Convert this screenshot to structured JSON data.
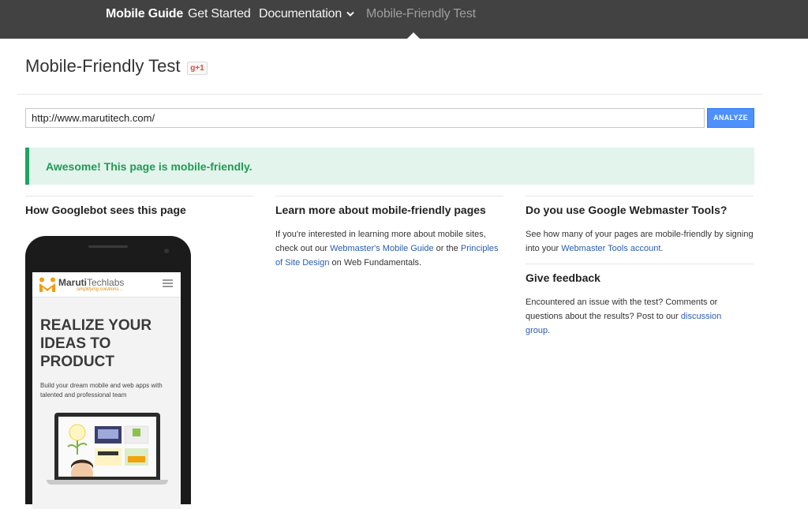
{
  "nav": {
    "brand": "Mobile Guide",
    "items": [
      "Get Started",
      "Documentation",
      "Mobile-Friendly Test"
    ]
  },
  "header": {
    "title": "Mobile-Friendly Test",
    "gplus_label": "g+1"
  },
  "form": {
    "url_value": "http://www.marutitech.com/",
    "analyze_label": "ANALYZE"
  },
  "result": {
    "message": "Awesome! This page is mobile-friendly."
  },
  "col1": {
    "heading": "How Googlebot sees this page"
  },
  "col2": {
    "heading": "Learn more about mobile-friendly pages",
    "text_1": "If you're interested in learning more about mobile sites, check out our ",
    "link_1": "Webmaster's Mobile Guide",
    "text_2": " or the ",
    "link_2": "Principles of Site Design",
    "text_3": " on Web Fundamentals."
  },
  "col3": {
    "heading": "Do you use Google Webmaster Tools?",
    "text_1": "See how many of your pages are mobile-friendly by signing into your ",
    "link_1": "Webmaster Tools account",
    "text_2": ".",
    "feedback_heading": "Give feedback",
    "feedback_text": "Encountered an issue with the test? Comments or questions about the results? Post to our ",
    "feedback_link": "discussion group",
    "feedback_end": "."
  },
  "phone_preview": {
    "brand_a": "Maruti",
    "brand_b": "Techlabs",
    "tagline": "simplifying solutions...",
    "hero": "REALIZE YOUR IDEAS TO PRODUCT",
    "subtext": "Build your dream mobile and web apps with talented and professional team"
  },
  "colors": {
    "nav_bg": "#424242",
    "accent_blue": "#4d90fe",
    "success_green": "#1da462",
    "success_bg": "#e3f4ec",
    "link": "#2a5db0"
  }
}
